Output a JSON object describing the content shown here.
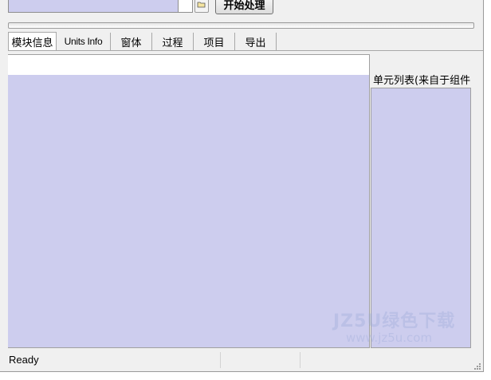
{
  "toolbar": {
    "start_button_label": "开始处理",
    "browse_icon": "folder-open-icon"
  },
  "progress": {
    "value": 0
  },
  "tabs": [
    {
      "label": "模块信息",
      "active": true
    },
    {
      "label": "Units Info",
      "active": false
    },
    {
      "label": "窗体",
      "active": false
    },
    {
      "label": "过程",
      "active": false
    },
    {
      "label": "项目",
      "active": false
    },
    {
      "label": "导出",
      "active": false
    }
  ],
  "right_panel": {
    "label": "单元列表(来自于组件"
  },
  "status_bar": {
    "text": "Ready"
  },
  "watermark": {
    "line1": "JZ5U绿色下载",
    "line2": "www.jz5u.com"
  },
  "colors": {
    "list_background": "#cdcdee",
    "window_background": "#f0f0f0"
  }
}
